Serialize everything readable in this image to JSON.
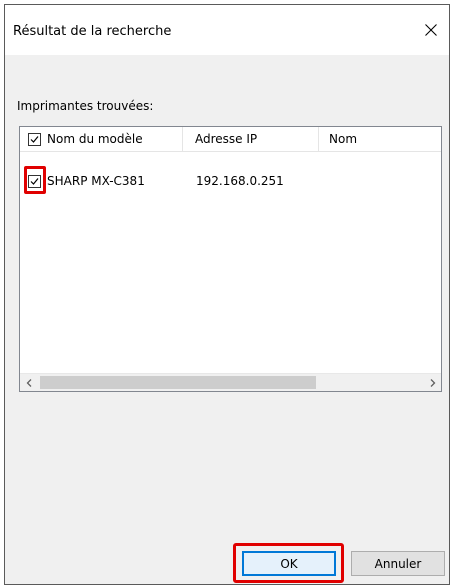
{
  "window": {
    "title": "Résultat de la recherche",
    "close_icon": "close-icon"
  },
  "main": {
    "section_label": "Imprimantes trouvées:",
    "list": {
      "columns": [
        "Nom du modèle",
        "Adresse IP",
        "Nom"
      ],
      "header_checkbox_checked": true,
      "rows": [
        {
          "model": "SHARP MX-C381",
          "ip": "192.168.0.251",
          "name": "",
          "checked": true
        }
      ]
    }
  },
  "buttons": {
    "ok": "OK",
    "cancel": "Annuler"
  },
  "annotations": {
    "highlight_color": "#e00000"
  }
}
